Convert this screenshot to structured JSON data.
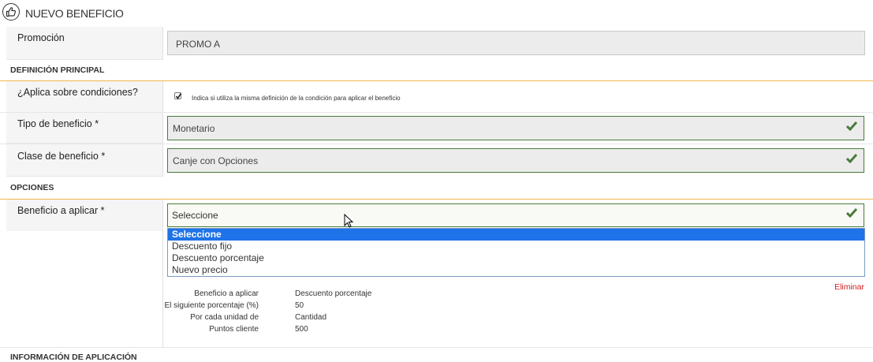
{
  "header": {
    "title": "NUEVO BENEFICIO",
    "icon": "thumbs-up-icon"
  },
  "promotion": {
    "label": "Promoción",
    "value": "PROMO A"
  },
  "sections": {
    "main": "DEFINICIÓN PRINCIPAL",
    "options": "OPCIONES",
    "application": "INFORMACIÓN DE APLICACIÓN"
  },
  "applies_conditions": {
    "label": "¿Aplica sobre condiciones?",
    "checked": true,
    "help": "Indica si utiliza la misma definición de la condición para aplicar el beneficio"
  },
  "benefit_type": {
    "label": "Tipo de beneficio *",
    "value": "Monetario"
  },
  "benefit_class": {
    "label": "Clase de beneficio *",
    "value": "Canje con Opciones"
  },
  "benefit_apply": {
    "label": "Beneficio a aplicar *",
    "value": "Seleccione",
    "options": [
      "Seleccione",
      "Descuento fijo",
      "Descuento porcentaje",
      "Nuevo precio"
    ],
    "selected_index": 0
  },
  "summary": {
    "rows": [
      {
        "label": "Beneficio a aplicar",
        "value": "Descuento porcentaje"
      },
      {
        "label": "El siguiente porcentaje (%)",
        "value": "50"
      },
      {
        "label": "Por cada unidad de",
        "value": "Cantidad"
      },
      {
        "label": "Puntos cliente",
        "value": "500"
      }
    ],
    "delete_label": "Eliminar"
  },
  "colors": {
    "accent": "#f0b84a",
    "valid": "#4b7a3a",
    "selected": "#1e73e8",
    "delete": "#d02020"
  }
}
